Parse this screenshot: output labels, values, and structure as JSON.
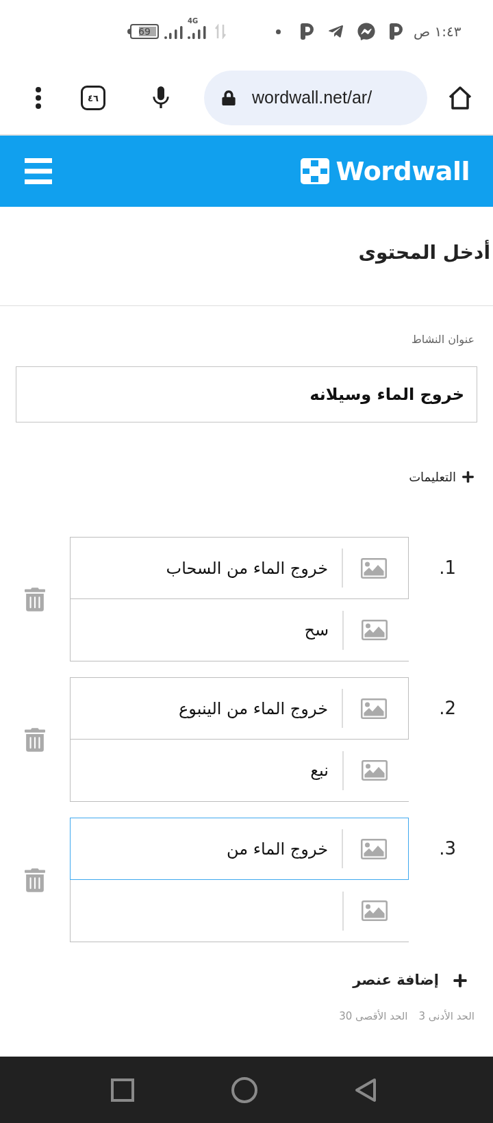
{
  "status_bar": {
    "time": "١:٤٣ ص",
    "battery": "69",
    "network": "4G"
  },
  "browser": {
    "tab_count": "٤٦",
    "url": "wordwall.net/ar/"
  },
  "header": {
    "logo": "Wordwall"
  },
  "content": {
    "heading": "أدخل المحتوى",
    "title_field": {
      "label": "عنوان النشاط",
      "value": "خروج الماء وسيلانه"
    },
    "instructions_button": "التعليمات",
    "items": [
      {
        "number": "1.",
        "fields": [
          {
            "value": "خروج الماء من السحاب",
            "focused": false
          },
          {
            "value": "سح",
            "focused": false
          }
        ]
      },
      {
        "number": "2.",
        "fields": [
          {
            "value": "خروج الماء من الينبوع",
            "focused": false
          },
          {
            "value": "نبع",
            "focused": false
          }
        ]
      },
      {
        "number": "3.",
        "fields": [
          {
            "value": "خروج الماء من",
            "focused": true
          },
          {
            "focused": false
          }
        ]
      }
    ],
    "add_item_button": "إضافة عنصر",
    "limits": [
      "الحد الأدنى 3",
      "الحد الأقصى 30"
    ]
  }
}
